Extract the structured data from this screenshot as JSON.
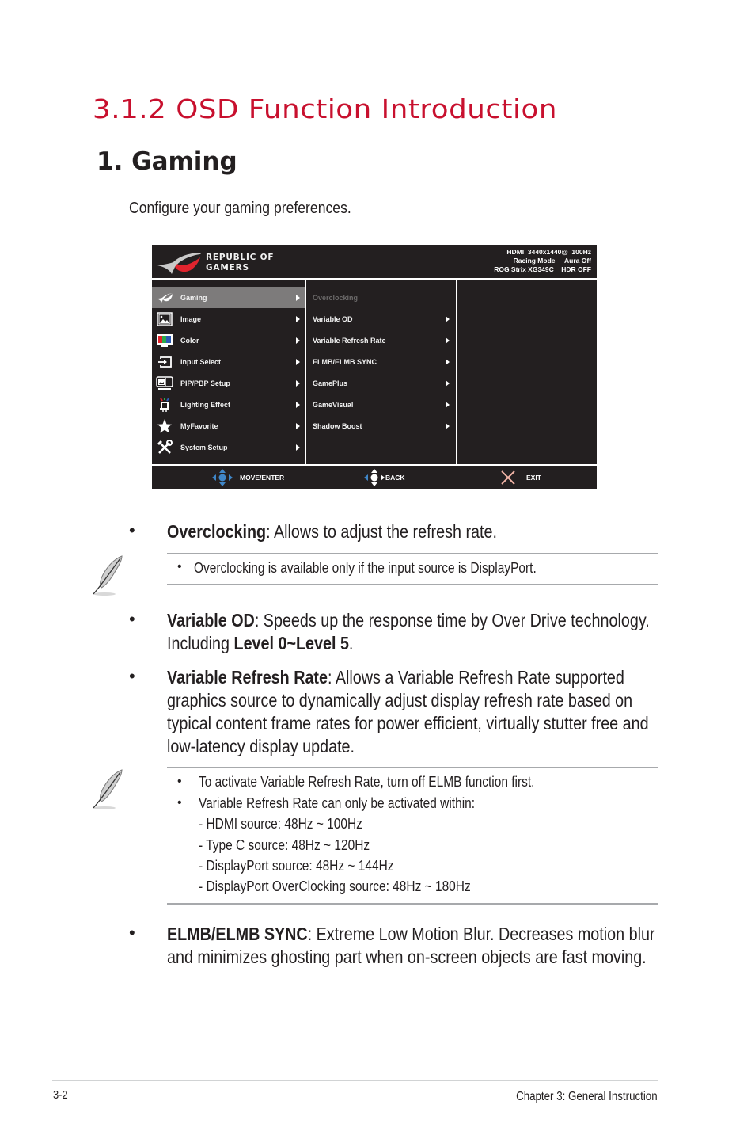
{
  "page": {
    "section_title": "3.1.2 OSD Function Introduction",
    "subsection_title": "1. Gaming",
    "intro": "Configure your gaming preferences."
  },
  "osd": {
    "brand_line1": "REPUBLIC OF",
    "brand_line2": "GAMERS",
    "status": {
      "line1": "HDMI  3440x1440@  100Hz",
      "line2": "Racing Mode     Aura Off",
      "line3": "ROG Strix XG349C    HDR OFF"
    },
    "main_menu": [
      {
        "label": "Gaming",
        "icon": "rog-icon",
        "active": true
      },
      {
        "label": "Image",
        "icon": "image-icon"
      },
      {
        "label": "Color",
        "icon": "color-icon"
      },
      {
        "label": "Input Select",
        "icon": "input-select-icon"
      },
      {
        "label": "PIP/PBP Setup",
        "icon": "pip-pbp-icon"
      },
      {
        "label": "Lighting Effect",
        "icon": "lighting-icon"
      },
      {
        "label": "MyFavorite",
        "icon": "star-icon"
      },
      {
        "label": "System Setup",
        "icon": "wrench-icon"
      }
    ],
    "sub_menu": [
      {
        "label": "Overclocking",
        "disabled": true
      },
      {
        "label": "Variable OD"
      },
      {
        "label": "Variable Refresh Rate"
      },
      {
        "label": "ELMB/ELMB SYNC"
      },
      {
        "label": "GamePlus"
      },
      {
        "label": "GameVisual"
      },
      {
        "label": "Shadow Boost"
      }
    ],
    "footer": {
      "move_enter": "MOVE/ENTER",
      "back": "BACK",
      "exit": "EXIT"
    },
    "colors": {
      "background": "#231f20",
      "active_item": "#7d7b7b",
      "nav_blue": "#3f86c8",
      "exit_x": "#f2b4a6"
    }
  },
  "bullets": {
    "overclocking": {
      "term": "Overclocking",
      "desc": ": Allows to adjust the refresh rate."
    },
    "variable_od": {
      "term": "Variable OD",
      "desc1": ": Speeds up the response time by Over Drive technology. Including ",
      "levels": "Level 0~Level 5",
      "desc2": "."
    },
    "vrr": {
      "term": "Variable Refresh Rate",
      "desc": ": Allows a Variable Refresh Rate supported graphics source to dynamically adjust display refresh rate based on typical content frame rates for power efficient, virtually stutter free and low-latency display update."
    },
    "elmb": {
      "term": "ELMB/ELMB SYNC",
      "desc": ": Extreme Low Motion Blur. Decreases motion blur and minimizes ghosting part when on-screen objects are fast moving."
    }
  },
  "notes": {
    "note1": "Overclocking is available only if the input source is DisplayPort.",
    "note2_item1": "To activate Variable Refresh Rate, turn off ELMB function first.",
    "note2_item2": "Variable Refresh Rate can only be activated within:",
    "note2_ranges": [
      "- HDMI source: 48Hz ~ 100Hz",
      "- Type C source: 48Hz ~ 120Hz",
      "- DisplayPort source: 48Hz ~ 144Hz",
      "- DisplayPort OverClocking source: 48Hz ~ 180Hz"
    ]
  },
  "footer": {
    "page_number": "3-2",
    "chapter": "Chapter 3: General Instruction"
  },
  "colors": {
    "title_red": "#c8102e",
    "text": "#231f20",
    "rule": "#a7a9ac"
  }
}
